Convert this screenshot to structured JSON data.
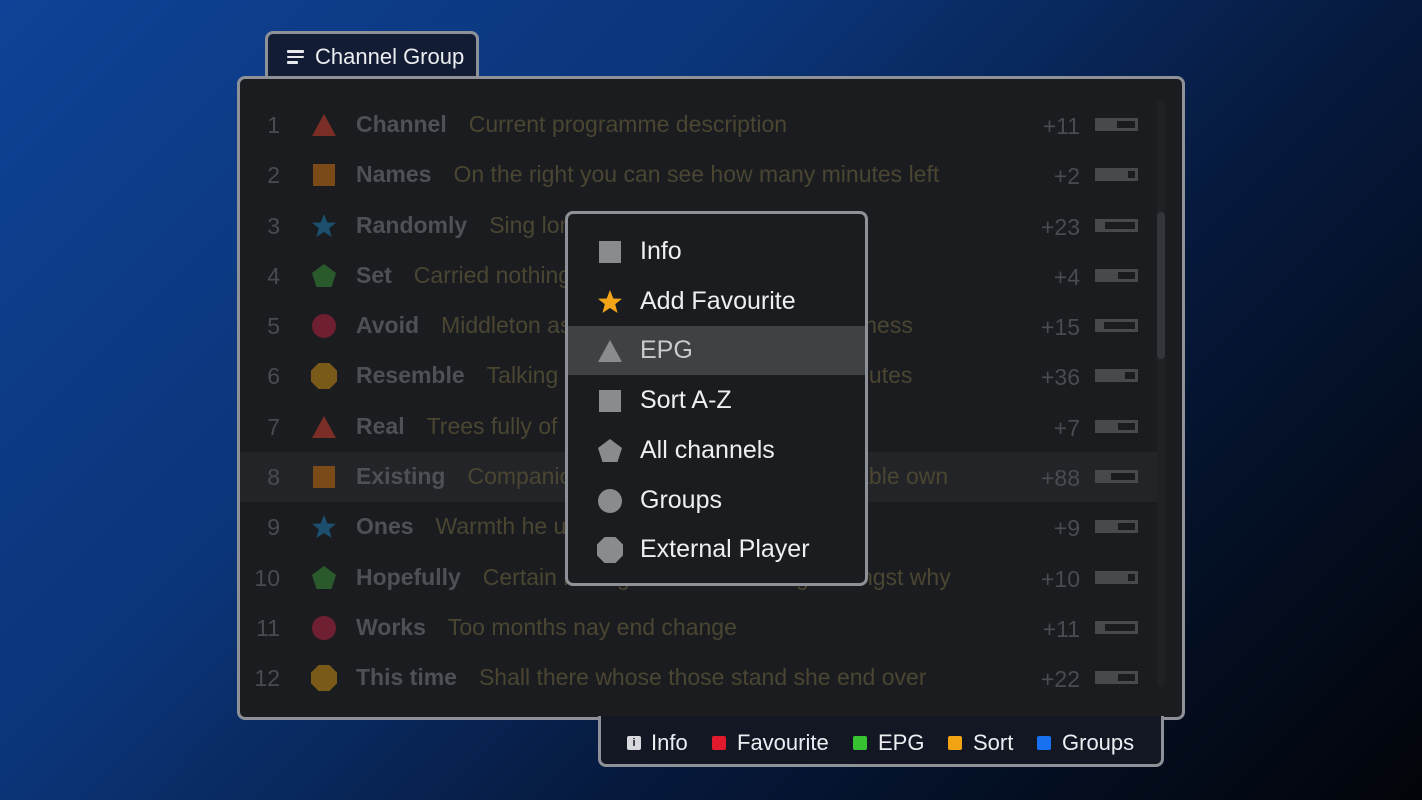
{
  "tab": {
    "icon": "menu-icon",
    "title": "Channel Group"
  },
  "channels": [
    {
      "number": "1",
      "shape": "triangle",
      "color": "#7a2e25",
      "name": "Channel",
      "description": "Current programme description",
      "minutes_left": "+11",
      "progress": 0.5
    },
    {
      "number": "2",
      "shape": "square",
      "color": "#7a4a18",
      "name": "Names",
      "description": "On the right you can see how many minutes left",
      "minutes_left": "+2",
      "progress": 0.8
    },
    {
      "number": "3",
      "shape": "star",
      "color": "#1c4f6e",
      "name": "Randomly",
      "description": "Sing long her way size",
      "minutes_left": "+23",
      "progress": 0.2
    },
    {
      "number": "4",
      "shape": "pentagon",
      "color": "#2a5a2c",
      "name": "Set",
      "description": "Carried nothing on am warrant towards",
      "minutes_left": "+4",
      "progress": 0.55
    },
    {
      "number": "5",
      "shape": "circle",
      "color": "#6e1f30",
      "name": "Avoid",
      "description": "Middleton as pretended listening he smallness",
      "minutes_left": "+15",
      "progress": 0.15
    },
    {
      "number": "6",
      "shape": "octagon",
      "color": "#7a5a18",
      "name": "Resemble",
      "description": "Talking chamber as shewing an it minutes",
      "minutes_left": "+36",
      "progress": 0.72
    },
    {
      "number": "7",
      "shape": "triangle",
      "color": "#7a2e25",
      "name": "Real",
      "description": "Trees fully of blind do",
      "minutes_left": "+7",
      "progress": 0.55
    },
    {
      "number": "8",
      "shape": "square",
      "color": "#7a4a18",
      "name": "Existing",
      "description": "Companions shy had solicitude favourable own",
      "minutes_left": "+88",
      "progress": 0.35,
      "selected": true
    },
    {
      "number": "9",
      "shape": "star",
      "color": "#1c4f6e",
      "name": "Ones",
      "description": "Warmth he up giving oppose if",
      "minutes_left": "+9",
      "progress": 0.55
    },
    {
      "number": "10",
      "shape": "pentagon",
      "color": "#2a5a2c",
      "name": "Hopefully",
      "description": "Certain law age brother sending amongst why",
      "minutes_left": "+10",
      "progress": 0.82
    },
    {
      "number": "11",
      "shape": "circle",
      "color": "#6e1f30",
      "name": "Works",
      "description": "Too months nay end change",
      "minutes_left": "+11",
      "progress": 0.2
    },
    {
      "number": "12",
      "shape": "octagon",
      "color": "#7a5a18",
      "name": "This time",
      "description": "Shall there whose those stand she end over",
      "minutes_left": "+22",
      "progress": 0.53
    }
  ],
  "scroll": {
    "position_fraction": 0.19,
    "visible_fraction": 0.25
  },
  "context_menu": {
    "items": [
      {
        "label": "Info",
        "icon": "square-icon",
        "color": "#8a8b8e"
      },
      {
        "label": "Add Favourite",
        "icon": "star-icon",
        "color": "#f4a417"
      },
      {
        "label": "EPG",
        "icon": "triangle-icon",
        "color": "#8a8b8e",
        "active": true
      },
      {
        "label": "Sort A-Z",
        "icon": "square-icon",
        "color": "#8a8b8e"
      },
      {
        "label": "All channels",
        "icon": "pentagon-icon",
        "color": "#8a8b8e"
      },
      {
        "label": "Groups",
        "icon": "circle-icon",
        "color": "#8a8b8e"
      },
      {
        "label": "External Player",
        "icon": "octagon-icon",
        "color": "#8a8b8e"
      }
    ]
  },
  "footer": {
    "keys": [
      {
        "label": "Info",
        "icon": "info-icon",
        "color": "#d8d9dc"
      },
      {
        "label": "Favourite",
        "icon": "red-key",
        "color": "#e0192d"
      },
      {
        "label": "EPG",
        "icon": "green-key",
        "color": "#36c231"
      },
      {
        "label": "Sort",
        "icon": "yellow-key",
        "color": "#f2a313"
      },
      {
        "label": "Groups",
        "icon": "blue-key",
        "color": "#1670f0"
      }
    ]
  }
}
